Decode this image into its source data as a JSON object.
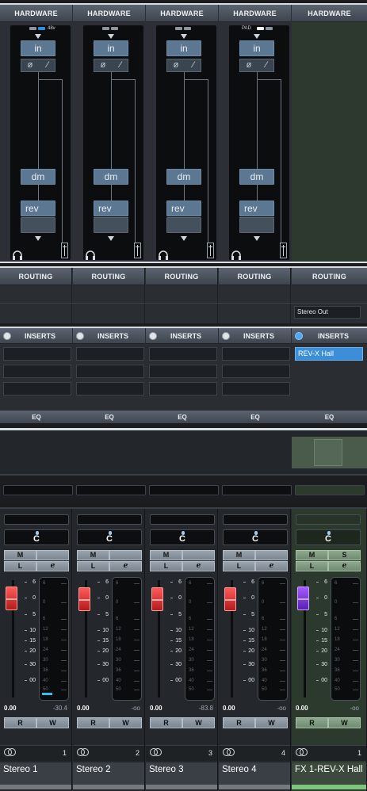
{
  "hardware": {
    "header": "HARDWARE",
    "channels": [
      {
        "leds": "48v",
        "in": "in",
        "phase": "ø",
        "filter": "∕",
        "dm": "dm",
        "rev": "rev"
      },
      {
        "leds": "",
        "in": "in",
        "phase": "ø",
        "filter": "∕",
        "dm": "dm",
        "rev": "rev"
      },
      {
        "leds": "",
        "in": "in",
        "phase": "ø",
        "filter": "∕",
        "dm": "dm",
        "rev": "rev"
      },
      {
        "leds": "PAD",
        "in": "in",
        "phase": "ø",
        "filter": "∕",
        "dm": "dm",
        "rev": "rev"
      }
    ]
  },
  "routing": {
    "header": "ROUTING",
    "fx_output": "Stereo Out"
  },
  "inserts": {
    "header": "INSERTS",
    "fx_slot": "REV-X Hall",
    "eq_header": "EQ"
  },
  "mixer": {
    "pan_label": "C",
    "buttons": {
      "mute": "M",
      "solo": "S",
      "listen": "L",
      "edit": "e",
      "read": "R",
      "write": "W"
    },
    "scale": [
      "6",
      "0",
      "5",
      "10",
      "15",
      "20",
      "30",
      "00"
    ],
    "meter_scale": [
      "6",
      "0",
      "6",
      "12",
      "18",
      "24",
      "30",
      "36",
      "40",
      "50"
    ],
    "channels": [
      {
        "number": "1",
        "name": "Stereo 1",
        "volume": "0.00",
        "peak": "-30.4"
      },
      {
        "number": "2",
        "name": "Stereo 2",
        "volume": "0.00",
        "peak": "-oo"
      },
      {
        "number": "3",
        "name": "Stereo 3",
        "volume": "0.00",
        "peak": "-83.8"
      },
      {
        "number": "4",
        "name": "Stereo 4",
        "volume": "0.00",
        "peak": "-oo"
      },
      {
        "number": "1",
        "name": "FX 1-REV-X Hall",
        "volume": "0.00",
        "peak": "-oo"
      }
    ]
  },
  "colors": {
    "accent_blue": "#3b8ed7",
    "fader_red": "#e03030",
    "fader_fx": "#8a3ef0",
    "fx_green": "#7cc47a"
  }
}
